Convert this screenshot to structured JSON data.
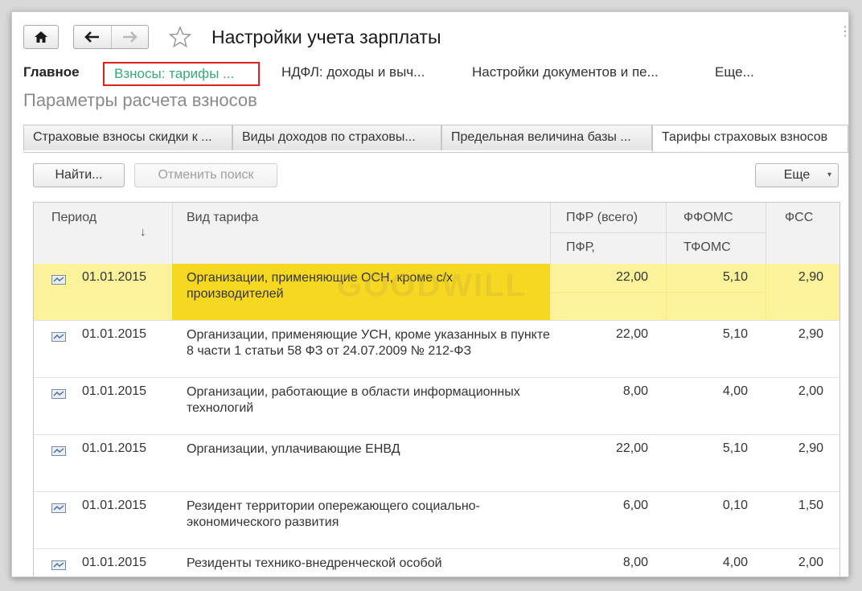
{
  "window": {
    "title": "Настройки учета зарплаты"
  },
  "sections": {
    "main": "Главное",
    "active": "Взносы: тарифы ...",
    "ndfl": "НДФЛ: доходы и выч...",
    "docs": "Настройки документов и пе...",
    "more": "Еще..."
  },
  "page_title": "Параметры расчета взносов",
  "tabs": [
    {
      "label": "Страховые взносы скидки к ..."
    },
    {
      "label": "Виды доходов по страховы..."
    },
    {
      "label": "Предельная величина базы ..."
    },
    {
      "label": "Тарифы страховых взносов"
    }
  ],
  "toolbar": {
    "find": "Найти...",
    "cancel_search": "Отменить поиск",
    "more": "Еще"
  },
  "table": {
    "headers": {
      "period": "Период",
      "sort_arrow": "↓",
      "vid": "Вид тарифа",
      "pfr_total": "ПФР (всего)",
      "pfr": "ПФР,",
      "ffoms": "ФФОМС",
      "tfoms": "ТФОМС",
      "fss": "ФСС"
    },
    "rows": [
      {
        "period": "01.01.2015",
        "vid": "Организации, применяющие ОСН, кроме с/х производителей",
        "pfr": "22,00",
        "ffoms": "5,10",
        "fss": "2,90"
      },
      {
        "period": "01.01.2015",
        "vid": "Организации, применяющие УСН, кроме указанных в пункте 8 части 1 статьи 58 ФЗ от 24.07.2009 № 212-ФЗ",
        "pfr": "22,00",
        "ffoms": "5,10",
        "fss": "2,90"
      },
      {
        "period": "01.01.2015",
        "vid": "Организации, работающие в области информационных технологий",
        "pfr": "8,00",
        "ffoms": "4,00",
        "fss": "2,00"
      },
      {
        "period": "01.01.2015",
        "vid": "Организации, уплачивающие ЕНВД",
        "pfr": "22,00",
        "ffoms": "5,10",
        "fss": "2,90"
      },
      {
        "period": "01.01.2015",
        "vid": "Резидент территории опережающего социально-экономического развития",
        "pfr": "6,00",
        "ffoms": "0,10",
        "fss": "1,50"
      },
      {
        "period": "01.01.2015",
        "vid": "Резиденты технико-внедренческой особой",
        "pfr": "8,00",
        "ffoms": "4,00",
        "fss": "2,00"
      }
    ]
  },
  "watermark": "GOODWILL",
  "colors": {
    "selected_row": "#fbf29a",
    "selected_cell": "#f7d820",
    "active_section_text": "#3aa876",
    "highlight_border": "#e02020"
  }
}
